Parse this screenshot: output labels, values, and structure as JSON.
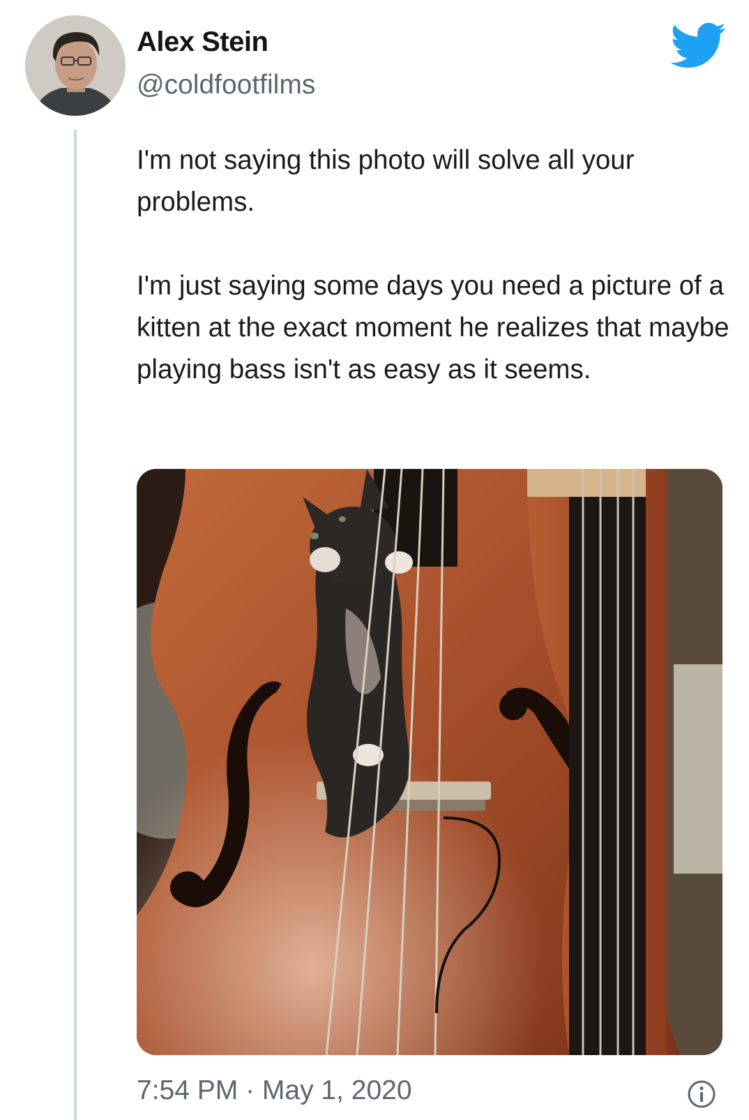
{
  "author": {
    "display_name": "Alex Stein",
    "handle": "@coldfootfilms"
  },
  "tweet": {
    "paragraph_1": "I'm not saying this photo will solve all your problems.",
    "paragraph_2": "I'm just saying some days you need a picture of a kitten at the exact moment he realizes that maybe playing bass isn't as easy as it seems."
  },
  "meta": {
    "time": "7:54 PM",
    "separator": " · ",
    "date": "May 1, 2020"
  },
  "icons": {
    "brand": "twitter-bird-icon",
    "info": "info-icon"
  },
  "colors": {
    "twitter_blue": "#1da1f2",
    "secondary_text": "#5b6670",
    "thread_line": "#cfd5da"
  }
}
